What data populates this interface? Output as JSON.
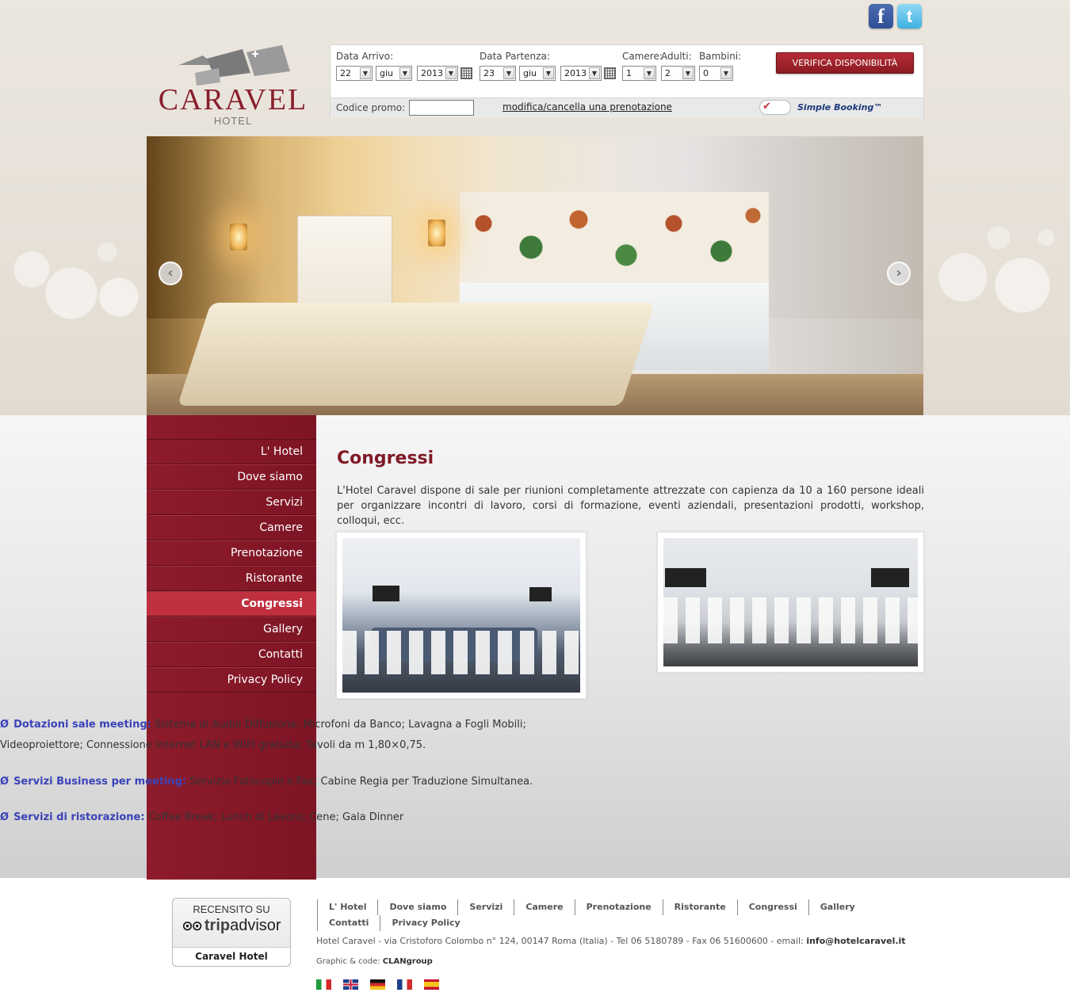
{
  "social": {
    "facebook_icon": "facebook-icon",
    "twitter_icon": "twitter-icon"
  },
  "logo": {
    "name": "CARAVEL",
    "sub": "HOTEL"
  },
  "booking": {
    "arrival_label": "Data Arrivo:",
    "departure_label": "Data Partenza:",
    "rooms_label": "Camere:",
    "adults_label": "Adulti:",
    "children_label": "Bambini:",
    "arrival_day": "22",
    "arrival_month": "giu",
    "arrival_year": "2013",
    "departure_day": "23",
    "departure_month": "giu",
    "departure_year": "2013",
    "rooms": "1",
    "adults": "2",
    "children": "0",
    "verify_button": "VERIFICA DISPONIBILITÀ",
    "promo_label": "Codice promo:",
    "modify_link": "modifica/cancella una prenotazione",
    "simple_booking": "Simple Booking™"
  },
  "sidebar": {
    "items": [
      {
        "label": "L' Hotel"
      },
      {
        "label": "Dove siamo"
      },
      {
        "label": "Servizi"
      },
      {
        "label": "Camere"
      },
      {
        "label": "Prenotazione"
      },
      {
        "label": "Ristorante"
      },
      {
        "label": "Congressi"
      },
      {
        "label": "Gallery"
      },
      {
        "label": "Contatti"
      },
      {
        "label": "Privacy Policy"
      }
    ]
  },
  "main": {
    "title": "Congressi",
    "intro": "L'Hotel Caravel dispone di sale per riunioni completamente attrezzate con capienza da 10 a 160 persone ideali per organizzare incontri di lavoro, corsi di formazione, eventi aziendali, presentazioni prodotti, workshop, colloqui, ecc.",
    "bullet": "Ø",
    "features": [
      {
        "title": "Dotazioni sale meeting:",
        "text": " Sistema di Audio Diffusione; Microfoni da Banco; Lavagna a Fogli Mobili;  Videoproiettore; Connessione Internet LAN e WIFI gratuita;  Tavoli da m 1,80×0,75."
      },
      {
        "title": "Servizi Business per meeting:",
        "text": " Servizio Fotocopie e Fax; Cabine Regia per Traduzione Simultanea."
      },
      {
        "title": "Servizi di ristorazione:",
        "text": " Coffee Break; Lunch di Lavoro; Cene; Gala Dinner"
      }
    ]
  },
  "footer": {
    "ta_top": "RECENSITO SU",
    "ta_owl": "⊙⊙",
    "ta_trip": "trip",
    "ta_advisor": "advisor",
    "ta_hotel": "Caravel Hotel",
    "nav": [
      "L' Hotel",
      "Dove siamo",
      "Servizi",
      "Camere",
      "Prenotazione",
      "Ristorante",
      "Congressi",
      "Gallery",
      "Contatti",
      "Privacy Policy"
    ],
    "address": "Hotel Caravel - via Cristoforo Colombo n° 124, 00147 Roma (Italia) - Tel 06 5180789 - Fax 06 51600600 - email: ",
    "email": "info@hotelcaravel.it",
    "graphic_label": "Graphic & code: ",
    "graphic_name": "CLANgroup"
  }
}
